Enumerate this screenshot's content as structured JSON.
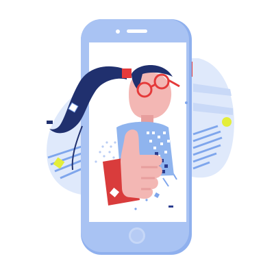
{
  "illustration": {
    "subject": "smartphone-thumbs-up-girl",
    "icons": [
      "smartphone-icon",
      "thumbs-up-icon",
      "glasses-icon",
      "ponytail-icon"
    ],
    "colors": {
      "background": "#ffffff",
      "phone_body": "#a9c3f3",
      "phone_edge": "#8fb0ee",
      "screen": "#ffffff",
      "backdrop_blob": "#dfe9fb",
      "stripe_blue": "#7fa6ec",
      "hair": "#20306e",
      "skin": "#f3b7b4",
      "skin_shadow": "#e79e9d",
      "glasses_red": "#e53a3a",
      "sleeve_red": "#d93c3c",
      "shirt_blue": "#8fb4ee",
      "pattern_dark": "#2b3d8f",
      "accent_yellow": "#e4ee3a"
    }
  }
}
